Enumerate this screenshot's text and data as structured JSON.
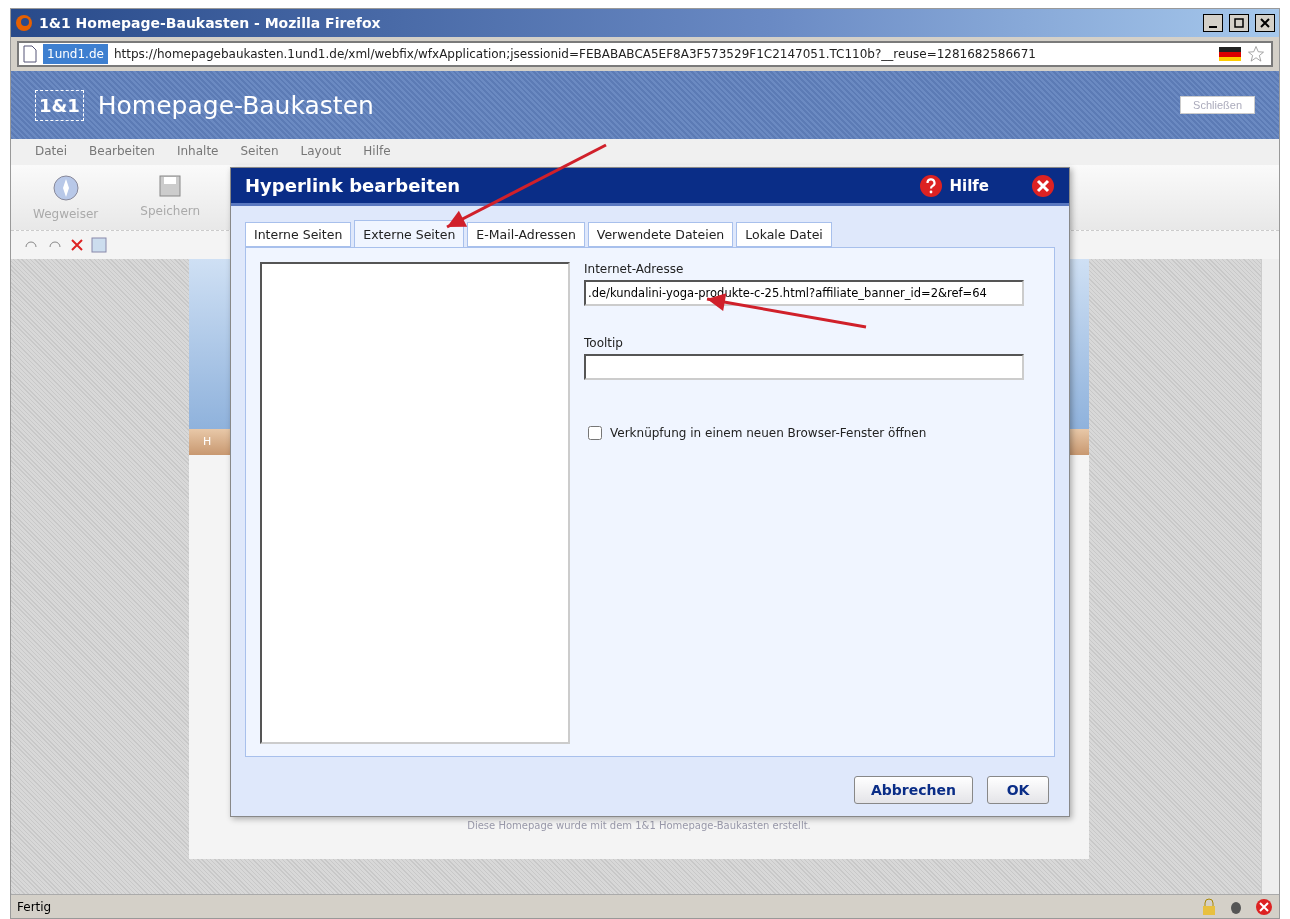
{
  "window": {
    "title": "1&1 Homepage-Baukasten - Mozilla Firefox"
  },
  "address_bar": {
    "site": "1und1.de",
    "url": "https://homepagebaukasten.1und1.de/xml/webfix/wfxApplication;jsessionid=FEBABABCA5EF8A3F573529F1C2147051.TC110b?__reuse=1281682586671"
  },
  "app_header": {
    "logo": "1&1",
    "title": "Homepage-Baukasten",
    "close_button": "Schließen"
  },
  "menu": [
    "Datei",
    "Bearbeiten",
    "Inhalte",
    "Seiten",
    "Layout",
    "Hilfe"
  ],
  "toolbar": [
    {
      "label": "Wegweiser",
      "kind": "compass"
    },
    {
      "label": "Speichern",
      "kind": "save"
    }
  ],
  "page_footer": "Diese Homepage wurde mit dem 1&1 Homepage-Baukasten erstellt.",
  "page_tab": "H",
  "dialog": {
    "title": "Hyperlink bearbeiten",
    "help": "Hilfe",
    "tabs": [
      {
        "label": "Interne Seiten",
        "selected": false
      },
      {
        "label": "Externe Seiten",
        "selected": true
      },
      {
        "label": "E-Mail-Adressen",
        "selected": false
      },
      {
        "label": "Verwendete Dateien",
        "selected": false
      },
      {
        "label": "Lokale Datei",
        "selected": false
      }
    ],
    "url_label": "Internet-Adresse",
    "url_value": ".de/kundalini-yoga-produkte-c-25.html?affiliate_banner_id=2&ref=64",
    "tooltip_label": "Tooltip",
    "new_window": {
      "label": "Verknüpfung in einem neuen Browser-Fenster öffnen",
      "checked": false
    },
    "buttons": [
      "Abbrechen",
      "OK"
    ]
  },
  "status_bar": {
    "text": "Fertig"
  }
}
